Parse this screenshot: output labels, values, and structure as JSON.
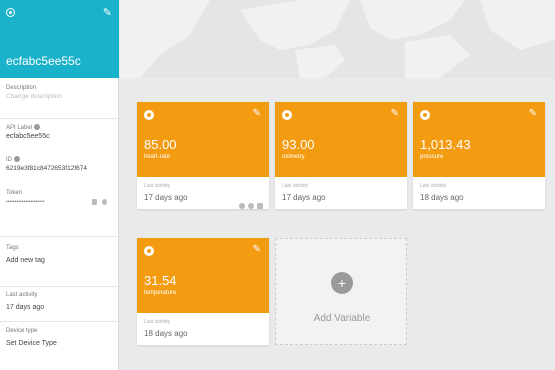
{
  "device": {
    "name": "ecfabc5ee55c",
    "description_label": "Description",
    "description_placeholder": "Change description",
    "api_label_label": "API Label",
    "api_label_value": "ecfabc5ee55c",
    "id_label": "ID",
    "id_value": "6219e3f81c8472653f12f674",
    "token_label": "Token",
    "token_value": "••••••••••••••••••••••",
    "tags_label": "Tags",
    "tags_placeholder": "Add new tag",
    "last_activity_label": "Last activity",
    "last_activity_value": "17 days ago",
    "device_type_label": "Device type",
    "device_type_value": "Set Device Type"
  },
  "variables": [
    {
      "value": "85.00",
      "name": "heart-rate",
      "last_activity_label": "Last activity",
      "last_activity": "17 days ago"
    },
    {
      "value": "93.00",
      "name": "oximetry",
      "last_activity_label": "Last activity",
      "last_activity": "17 days ago"
    },
    {
      "value": "1,013.43",
      "name": "pressure",
      "last_activity_label": "Last activity",
      "last_activity": "18 days ago"
    },
    {
      "value": "31.54",
      "name": "temperature",
      "last_activity_label": "Last activity",
      "last_activity": "18 days ago"
    }
  ],
  "add_variable_label": "Add Variable",
  "colors": {
    "header": "#1ab2ca",
    "card": "#f39c12"
  }
}
